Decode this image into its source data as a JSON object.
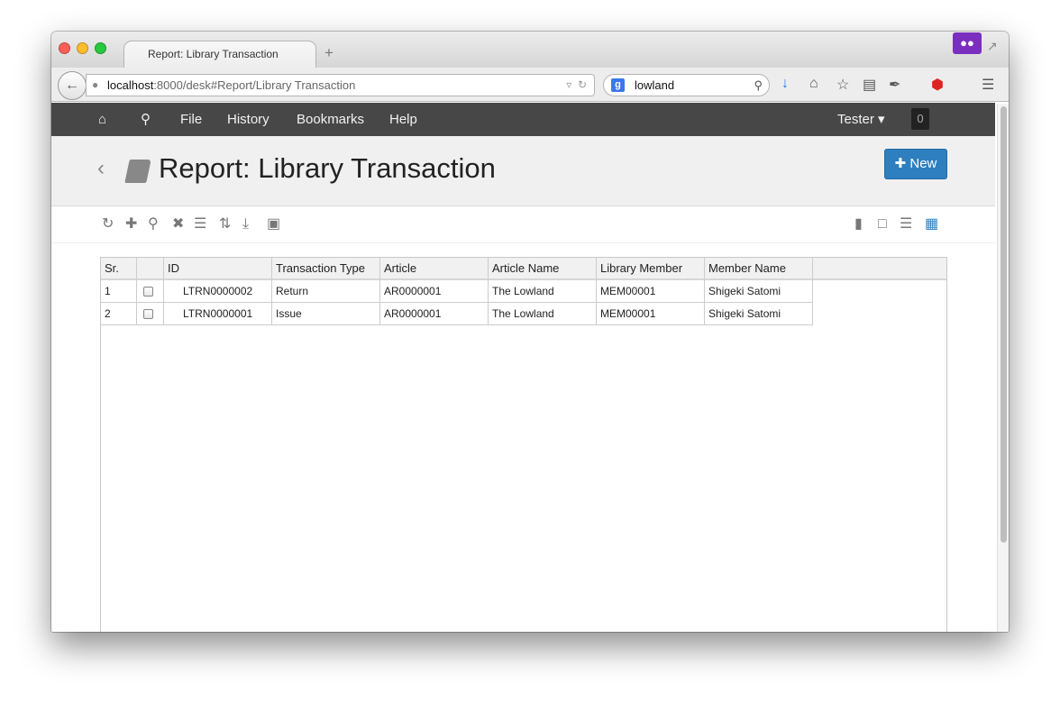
{
  "browser": {
    "tab_title": "Report: Library Transaction",
    "new_tab_symbol": "+",
    "url_host": "localhost",
    "url_rest": ":8000/desk#Report/Library Transaction",
    "search_value": "lowland",
    "search_engine_letter": "g"
  },
  "topnav": {
    "items": [
      "File",
      "History",
      "Bookmarks",
      "Help"
    ],
    "user": "Tester",
    "notification_count": "0"
  },
  "page": {
    "title": "Report: Library Transaction",
    "new_button": "New"
  },
  "toolbar_icons": [
    "refresh-icon",
    "add-icon",
    "search-icon",
    "clear-icon",
    "columns-icon",
    "sort-icon",
    "download-icon",
    "save-icon"
  ],
  "view_icons": [
    "book-icon",
    "file-icon",
    "list-icon",
    "grid-icon"
  ],
  "table": {
    "columns": [
      "Sr.",
      "",
      "ID",
      "Transaction Type",
      "Article",
      "Article Name",
      "Library Member",
      "Member Name"
    ],
    "rows": [
      {
        "sr": "1",
        "id": "LTRN0000002",
        "transaction_type": "Return",
        "article": "AR0000001",
        "article_name": "The Lowland",
        "library_member": "MEM00001",
        "member_name": "Shigeki Satomi"
      },
      {
        "sr": "2",
        "id": "LTRN0000001",
        "transaction_type": "Issue",
        "article": "AR0000001",
        "article_name": "The Lowland",
        "library_member": "MEM00001",
        "member_name": "Shigeki Satomi"
      }
    ]
  },
  "colors": {
    "navbar": "#474747",
    "primary": "#2d7fc0",
    "mask_addon": "#7b2fbf"
  }
}
